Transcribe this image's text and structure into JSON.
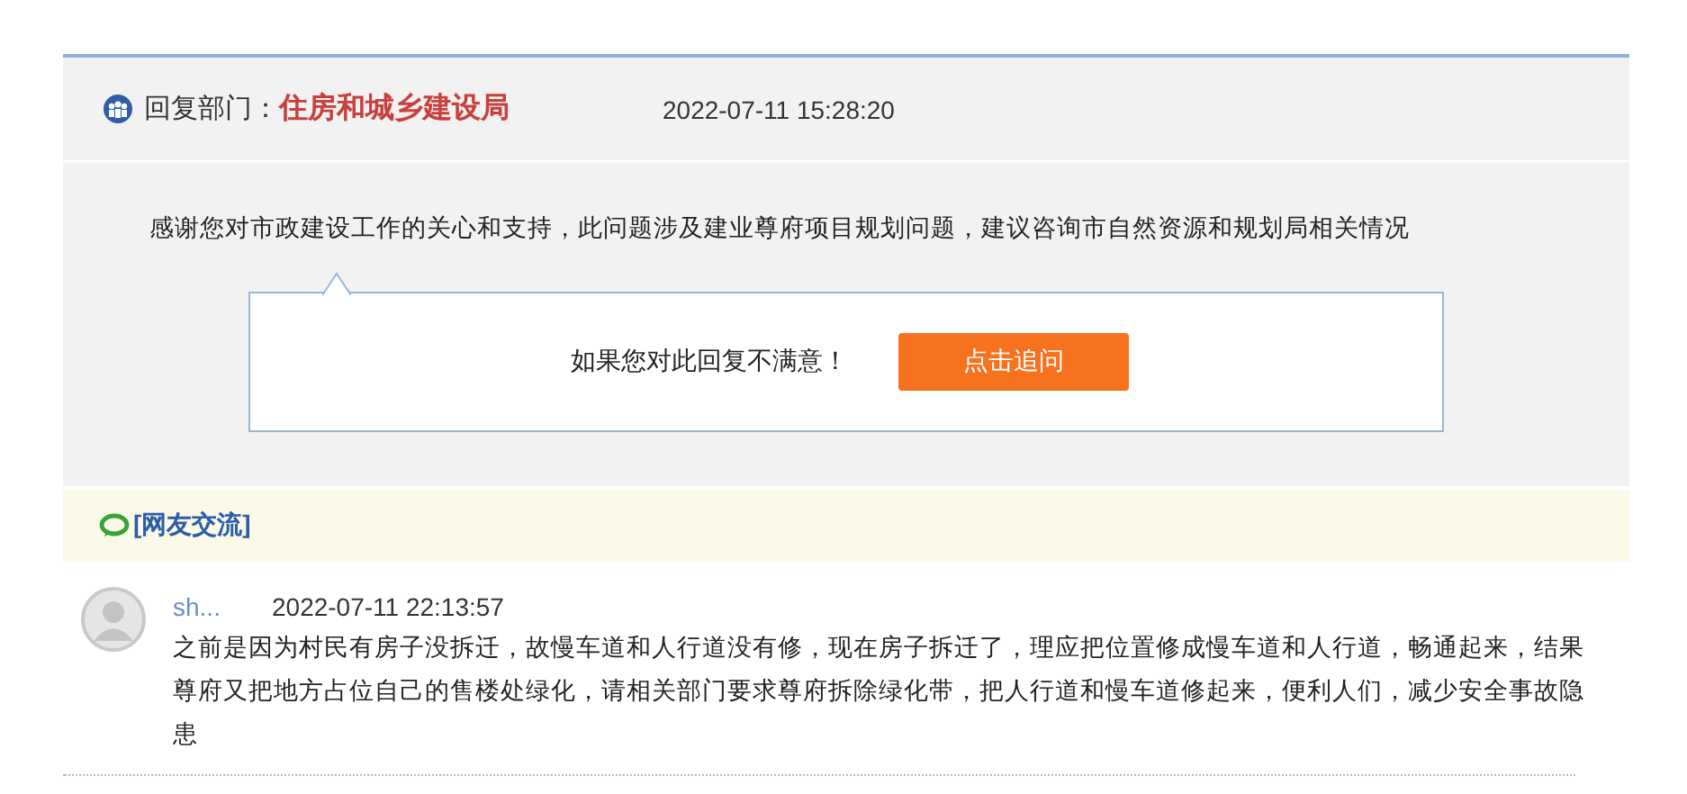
{
  "reply": {
    "label": "回复部门：",
    "department": "住房和城乡建设局",
    "time": "2022-07-11 15:28:20",
    "content": "感谢您对市政建设工作的关心和支持，此问题涉及建业尊府项目规划问题，建议咨询市自然资源和规划局相关情况"
  },
  "followup": {
    "prompt": "如果您对此回复不满意！",
    "button": "点击追问"
  },
  "discussion": {
    "title": "[网友交流]",
    "comments": [
      {
        "user": "sh...",
        "time": "2022-07-11 22:13:57",
        "text": "之前是因为村民有房子没拆迁，故慢车道和人行道没有修，现在房子拆迁了，理应把位置修成慢车道和人行道，畅通起来，结果尊府又把地方占位自己的售楼处绿化，请相关部门要求尊府拆除绿化带，把人行道和慢车道修起来，便利人们，减少安全事故隐患"
      }
    ]
  }
}
